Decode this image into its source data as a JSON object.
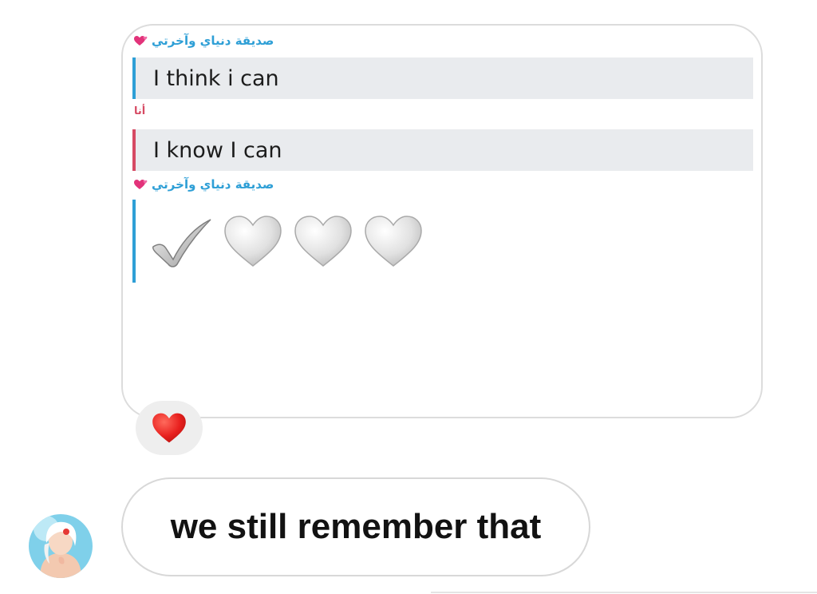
{
  "shared_snap": {
    "messages": [
      {
        "sender_name": "صديقة دنياي وآخرتي",
        "sender_emoji": "two-hearts-icon",
        "sender_color": "#2e9fd6",
        "text": "I think i can"
      },
      {
        "sender_name": "أنا",
        "sender_color": "#d64a63",
        "text": "I know I can"
      },
      {
        "sender_name": "صديقة دنياي وآخرتي",
        "sender_emoji": "two-hearts-icon",
        "sender_color": "#2e9fd6",
        "emoji_content": [
          "check-mark-icon",
          "white-heart-icon",
          "white-heart-icon",
          "white-heart-icon"
        ]
      }
    ]
  },
  "reaction": {
    "emoji": "red-heart-icon"
  },
  "chat": {
    "message_text": "we still remember that",
    "avatar": "user-avatar"
  }
}
